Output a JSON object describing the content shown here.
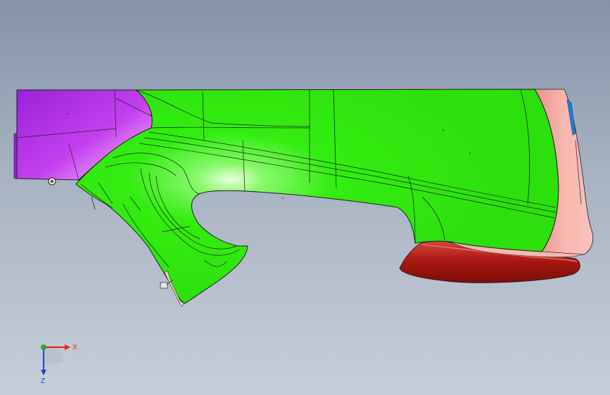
{
  "viewport": {
    "background_top": "#8593a9",
    "background_bottom": "#c7ced9"
  },
  "model": {
    "colors": {
      "main_body": "#33ee11",
      "left_block": "#bb33ee",
      "right_trim": "#f2b0a8",
      "bottom_trim": "#b5201a",
      "edge_lines": "#1a1a1a",
      "blue_detail": "#1f7fd6"
    }
  },
  "triad": {
    "x_label": "X",
    "z_label": "Z",
    "x_color": "#e02020",
    "y_color": "#20b030",
    "z_color": "#2040d0"
  }
}
